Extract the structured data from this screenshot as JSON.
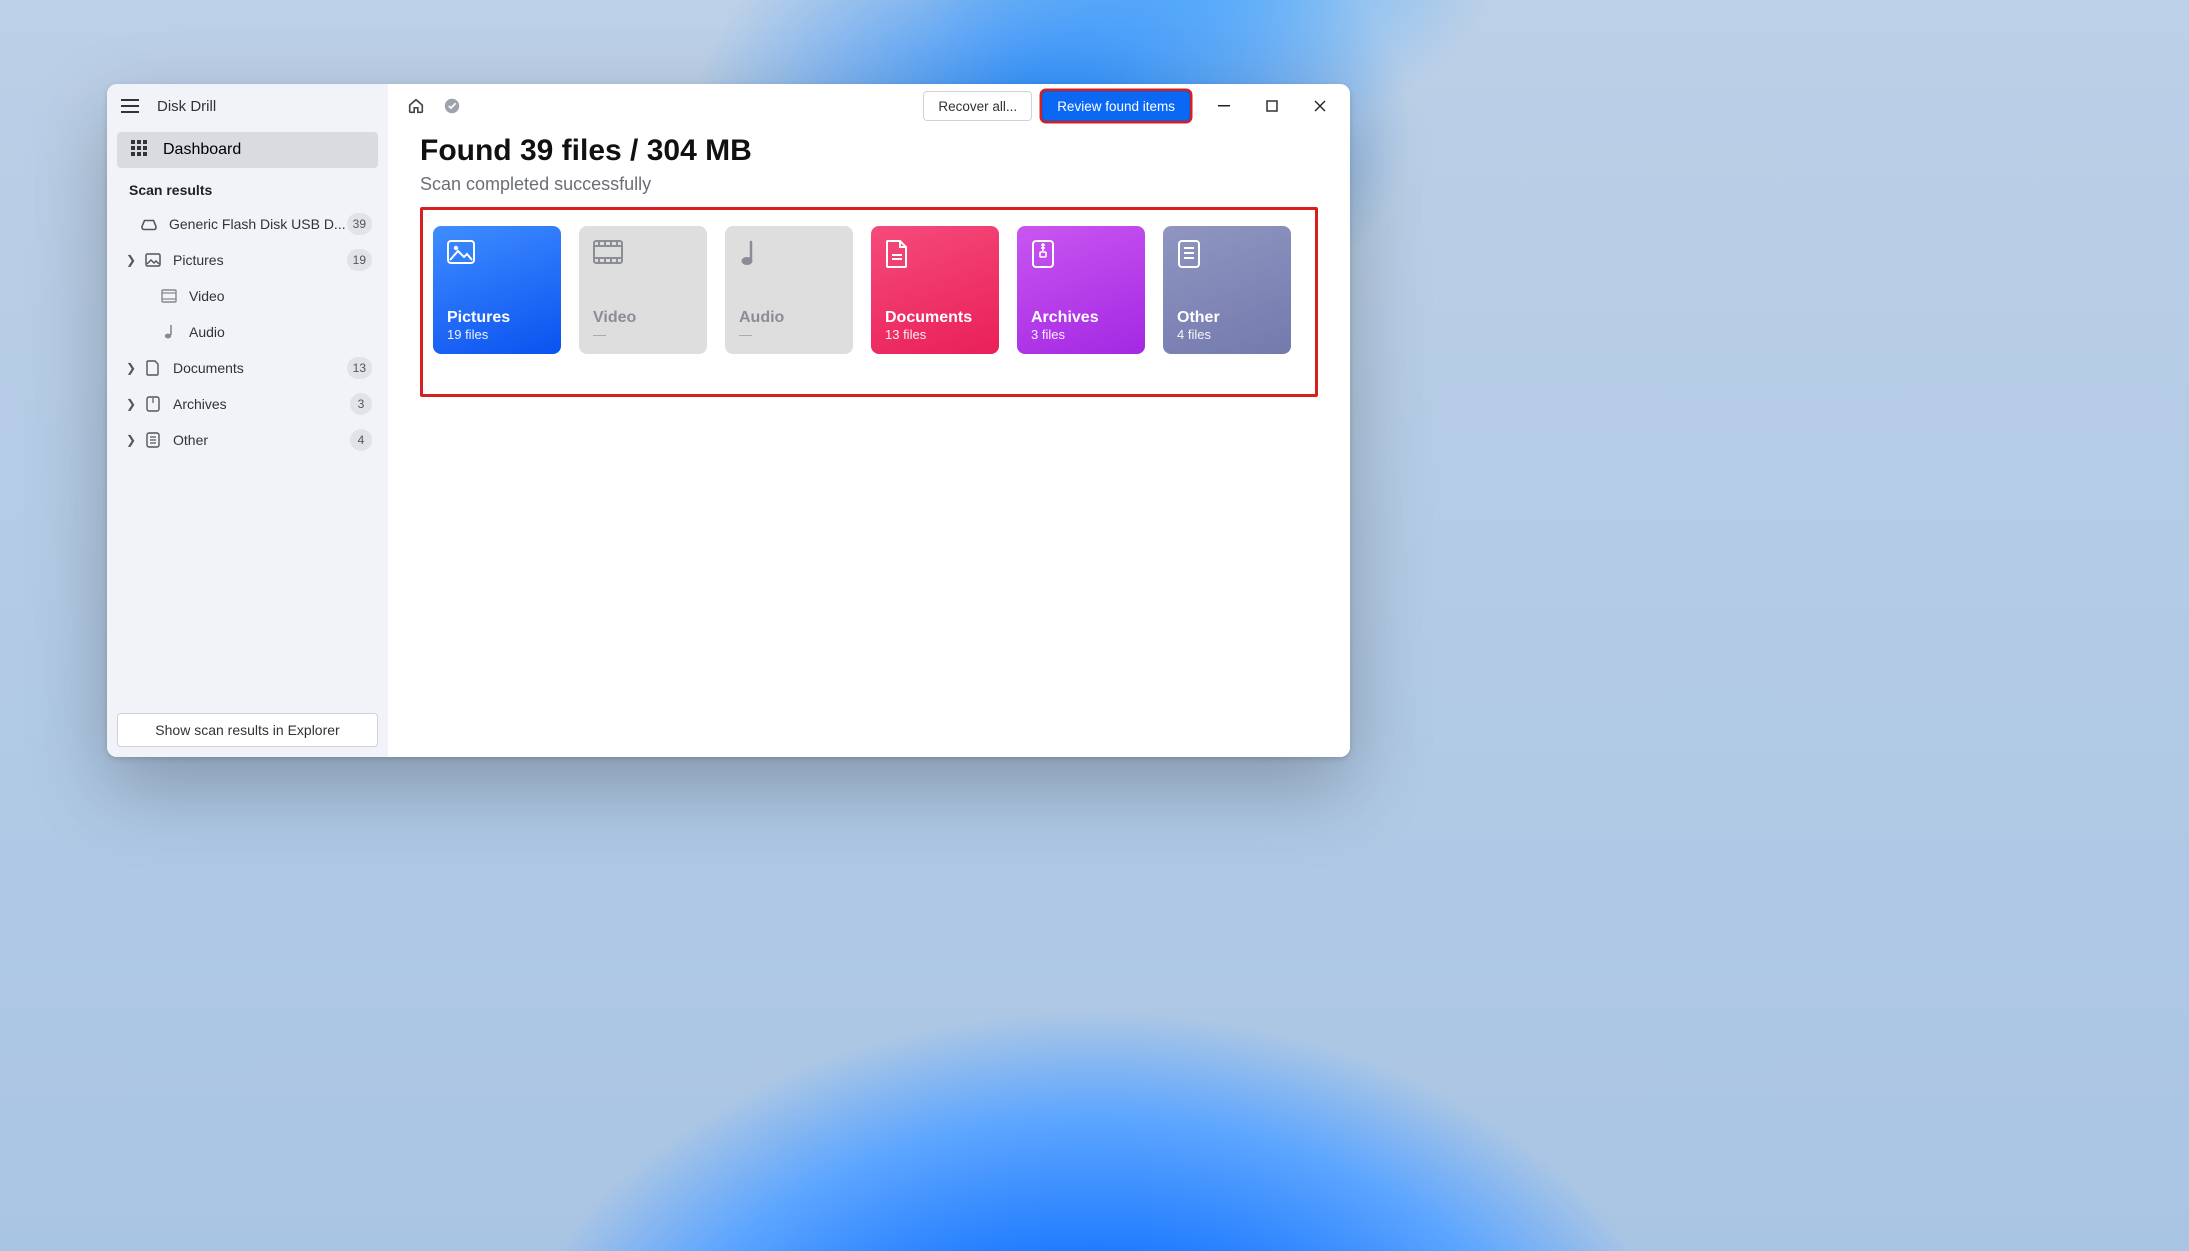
{
  "appTitle": "Disk Drill",
  "sidebar": {
    "dashboard": "Dashboard",
    "section": "Scan results",
    "disk": {
      "label": "Generic Flash Disk USB D...",
      "badge": "39"
    },
    "items": [
      {
        "label": "Pictures",
        "badge": "19",
        "expandable": true,
        "icon": "picture"
      },
      {
        "label": "Video",
        "badge": "",
        "expandable": false,
        "icon": "video"
      },
      {
        "label": "Audio",
        "badge": "",
        "expandable": false,
        "icon": "audio"
      },
      {
        "label": "Documents",
        "badge": "13",
        "expandable": true,
        "icon": "document"
      },
      {
        "label": "Archives",
        "badge": "3",
        "expandable": true,
        "icon": "archive"
      },
      {
        "label": "Other",
        "badge": "4",
        "expandable": true,
        "icon": "other"
      }
    ],
    "footerButton": "Show scan results in Explorer"
  },
  "toolbar": {
    "recoverAll": "Recover all...",
    "review": "Review found items"
  },
  "main": {
    "headline": "Found 39 files / 304 MB",
    "subhead": "Scan completed successfully"
  },
  "cards": [
    {
      "title": "Pictures",
      "sub": "19 files",
      "style": "pictures",
      "icon": "picture"
    },
    {
      "title": "Video",
      "sub": "—",
      "style": "disabled",
      "icon": "video"
    },
    {
      "title": "Audio",
      "sub": "—",
      "style": "disabled",
      "icon": "audio"
    },
    {
      "title": "Documents",
      "sub": "13 files",
      "style": "documents",
      "icon": "document"
    },
    {
      "title": "Archives",
      "sub": "3 files",
      "style": "archives",
      "icon": "archive"
    },
    {
      "title": "Other",
      "sub": "4 files",
      "style": "other",
      "icon": "other"
    }
  ]
}
